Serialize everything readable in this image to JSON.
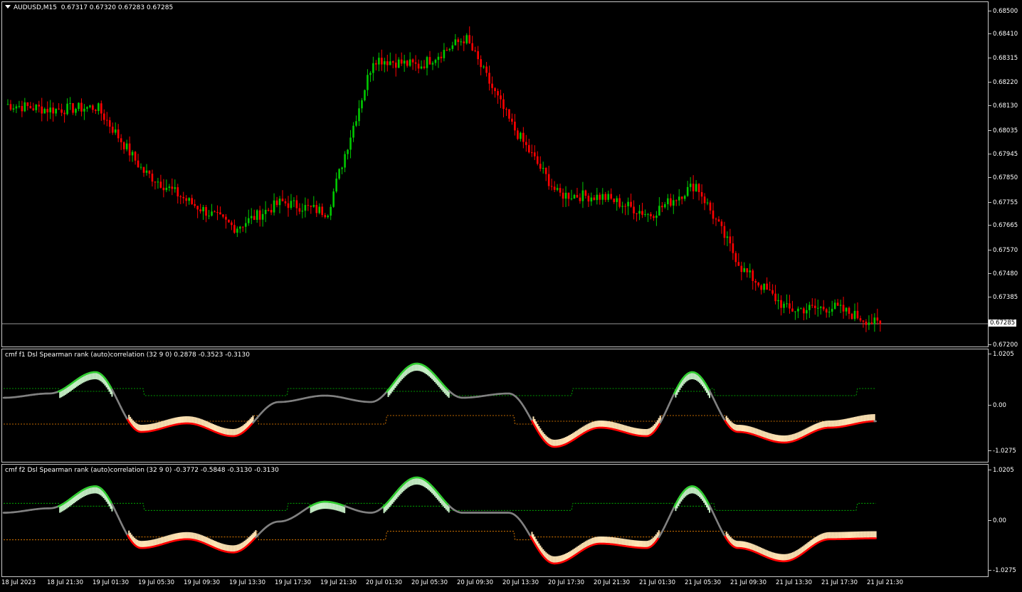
{
  "main": {
    "symbol": "AUDUSD,M15",
    "ohlc": "0.67317 0.67320 0.67283 0.67285",
    "price_levels": [
      "0.68500",
      "0.68410",
      "0.68315",
      "0.68220",
      "0.68130",
      "0.68035",
      "0.67945",
      "0.67850",
      "0.67755",
      "0.67665",
      "0.67570",
      "0.67480",
      "0.67385",
      "0.67200"
    ],
    "current_price": "0.67285",
    "bull_color": "#00c800",
    "bear_color": "#ff0000"
  },
  "indicator1": {
    "title": "cmf f1 Dsl Spearman rank (auto)correlation (32 9 0) 0.2878 -0.3523 -0.3130",
    "levels": [
      "1.0205",
      "0.00",
      "-1.0275"
    ]
  },
  "indicator2": {
    "title": "cmf f2 Dsl Spearman rank (auto)correlation (32 9 0) -0.3772 -0.5848 -0.3130 -0.3130",
    "levels": [
      "1.0205",
      "0.00",
      "-1.0275"
    ]
  },
  "time_axis": [
    "18 Jul 2023",
    "18 Jul 21:30",
    "19 Jul 01:30",
    "19 Jul 05:30",
    "19 Jul 09:30",
    "19 Jul 13:30",
    "19 Jul 17:30",
    "19 Jul 21:30",
    "20 Jul 01:30",
    "20 Jul 05:30",
    "20 Jul 09:30",
    "20 Jul 13:30",
    "20 Jul 17:30",
    "20 Jul 21:30",
    "21 Jul 01:30",
    "21 Jul 05:30",
    "21 Jul 09:30",
    "21 Jul 13:30",
    "21 Jul 17:30",
    "21 Jul 21:30"
  ],
  "chart_data": {
    "type": "line",
    "title": "AUDUSD,M15",
    "x": [
      "18 Jul 2023",
      "18 Jul 21:30",
      "19 Jul 01:30",
      "19 Jul 05:30",
      "19 Jul 09:30",
      "19 Jul 13:30",
      "19 Jul 17:30",
      "19 Jul 21:30",
      "20 Jul 01:30",
      "20 Jul 05:30",
      "20 Jul 09:30",
      "20 Jul 13:30",
      "20 Jul 17:30",
      "20 Jul 21:30",
      "21 Jul 01:30",
      "21 Jul 05:30",
      "21 Jul 09:30",
      "21 Jul 13:30",
      "21 Jul 17:30",
      "21 Jul 21:30"
    ],
    "series": [
      {
        "name": "AUDUSD,M15",
        "values": [
          0.6814,
          0.6812,
          0.6813,
          0.6788,
          0.6776,
          0.6766,
          0.6776,
          0.6772,
          0.6832,
          0.6829,
          0.684,
          0.6806,
          0.6779,
          0.6778,
          0.6771,
          0.6783,
          0.675,
          0.6734,
          0.6735,
          0.6728
        ]
      },
      {
        "name": "cmf f1",
        "values": [
          0.2,
          0.3,
          0.8,
          -0.6,
          -0.4,
          -0.7,
          0.1,
          0.25,
          0.1,
          1.0,
          0.2,
          0.3,
          -0.95,
          -0.5,
          -0.7,
          0.8,
          -0.6,
          -0.85,
          -0.5,
          -0.35
        ]
      },
      {
        "name": "cmf f2",
        "values": [
          0.2,
          0.3,
          0.8,
          -0.6,
          -0.4,
          -0.7,
          0.0,
          0.45,
          0.2,
          1.0,
          0.2,
          0.2,
          -0.95,
          -0.5,
          -0.6,
          0.8,
          -0.6,
          -0.9,
          -0.4,
          -0.38
        ]
      }
    ],
    "ylim": [
      0.672,
      0.685
    ]
  }
}
